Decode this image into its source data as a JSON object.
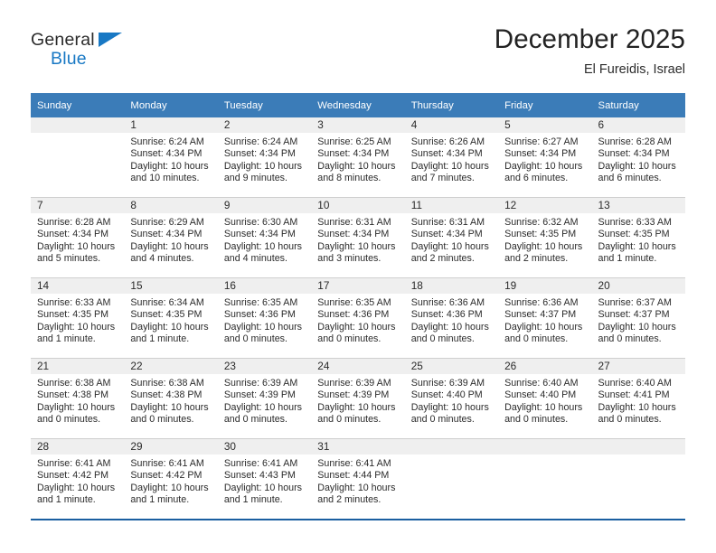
{
  "brand": {
    "name_part1": "General",
    "name_part2": "Blue",
    "triangle_icon": "triangle-icon",
    "accent_color": "#1878c4"
  },
  "header": {
    "title": "December 2025",
    "location": "El Fureidis, Israel"
  },
  "calendar": {
    "header_bg": "#3b7cb8",
    "daynum_bg": "#efefef",
    "weekday_headers": [
      "Sunday",
      "Monday",
      "Tuesday",
      "Wednesday",
      "Thursday",
      "Friday",
      "Saturday"
    ],
    "weeks": [
      [
        {
          "day": "",
          "blank": true
        },
        {
          "day": "1",
          "sunrise": "Sunrise: 6:24 AM",
          "sunset": "Sunset: 4:34 PM",
          "daylight1": "Daylight: 10 hours",
          "daylight2": "and 10 minutes."
        },
        {
          "day": "2",
          "sunrise": "Sunrise: 6:24 AM",
          "sunset": "Sunset: 4:34 PM",
          "daylight1": "Daylight: 10 hours",
          "daylight2": "and 9 minutes."
        },
        {
          "day": "3",
          "sunrise": "Sunrise: 6:25 AM",
          "sunset": "Sunset: 4:34 PM",
          "daylight1": "Daylight: 10 hours",
          "daylight2": "and 8 minutes."
        },
        {
          "day": "4",
          "sunrise": "Sunrise: 6:26 AM",
          "sunset": "Sunset: 4:34 PM",
          "daylight1": "Daylight: 10 hours",
          "daylight2": "and 7 minutes."
        },
        {
          "day": "5",
          "sunrise": "Sunrise: 6:27 AM",
          "sunset": "Sunset: 4:34 PM",
          "daylight1": "Daylight: 10 hours",
          "daylight2": "and 6 minutes."
        },
        {
          "day": "6",
          "sunrise": "Sunrise: 6:28 AM",
          "sunset": "Sunset: 4:34 PM",
          "daylight1": "Daylight: 10 hours",
          "daylight2": "and 6 minutes."
        }
      ],
      [
        {
          "day": "7",
          "sunrise": "Sunrise: 6:28 AM",
          "sunset": "Sunset: 4:34 PM",
          "daylight1": "Daylight: 10 hours",
          "daylight2": "and 5 minutes."
        },
        {
          "day": "8",
          "sunrise": "Sunrise: 6:29 AM",
          "sunset": "Sunset: 4:34 PM",
          "daylight1": "Daylight: 10 hours",
          "daylight2": "and 4 minutes."
        },
        {
          "day": "9",
          "sunrise": "Sunrise: 6:30 AM",
          "sunset": "Sunset: 4:34 PM",
          "daylight1": "Daylight: 10 hours",
          "daylight2": "and 4 minutes."
        },
        {
          "day": "10",
          "sunrise": "Sunrise: 6:31 AM",
          "sunset": "Sunset: 4:34 PM",
          "daylight1": "Daylight: 10 hours",
          "daylight2": "and 3 minutes."
        },
        {
          "day": "11",
          "sunrise": "Sunrise: 6:31 AM",
          "sunset": "Sunset: 4:34 PM",
          "daylight1": "Daylight: 10 hours",
          "daylight2": "and 2 minutes."
        },
        {
          "day": "12",
          "sunrise": "Sunrise: 6:32 AM",
          "sunset": "Sunset: 4:35 PM",
          "daylight1": "Daylight: 10 hours",
          "daylight2": "and 2 minutes."
        },
        {
          "day": "13",
          "sunrise": "Sunrise: 6:33 AM",
          "sunset": "Sunset: 4:35 PM",
          "daylight1": "Daylight: 10 hours",
          "daylight2": "and 1 minute."
        }
      ],
      [
        {
          "day": "14",
          "sunrise": "Sunrise: 6:33 AM",
          "sunset": "Sunset: 4:35 PM",
          "daylight1": "Daylight: 10 hours",
          "daylight2": "and 1 minute."
        },
        {
          "day": "15",
          "sunrise": "Sunrise: 6:34 AM",
          "sunset": "Sunset: 4:35 PM",
          "daylight1": "Daylight: 10 hours",
          "daylight2": "and 1 minute."
        },
        {
          "day": "16",
          "sunrise": "Sunrise: 6:35 AM",
          "sunset": "Sunset: 4:36 PM",
          "daylight1": "Daylight: 10 hours",
          "daylight2": "and 0 minutes."
        },
        {
          "day": "17",
          "sunrise": "Sunrise: 6:35 AM",
          "sunset": "Sunset: 4:36 PM",
          "daylight1": "Daylight: 10 hours",
          "daylight2": "and 0 minutes."
        },
        {
          "day": "18",
          "sunrise": "Sunrise: 6:36 AM",
          "sunset": "Sunset: 4:36 PM",
          "daylight1": "Daylight: 10 hours",
          "daylight2": "and 0 minutes."
        },
        {
          "day": "19",
          "sunrise": "Sunrise: 6:36 AM",
          "sunset": "Sunset: 4:37 PM",
          "daylight1": "Daylight: 10 hours",
          "daylight2": "and 0 minutes."
        },
        {
          "day": "20",
          "sunrise": "Sunrise: 6:37 AM",
          "sunset": "Sunset: 4:37 PM",
          "daylight1": "Daylight: 10 hours",
          "daylight2": "and 0 minutes."
        }
      ],
      [
        {
          "day": "21",
          "sunrise": "Sunrise: 6:38 AM",
          "sunset": "Sunset: 4:38 PM",
          "daylight1": "Daylight: 10 hours",
          "daylight2": "and 0 minutes."
        },
        {
          "day": "22",
          "sunrise": "Sunrise: 6:38 AM",
          "sunset": "Sunset: 4:38 PM",
          "daylight1": "Daylight: 10 hours",
          "daylight2": "and 0 minutes."
        },
        {
          "day": "23",
          "sunrise": "Sunrise: 6:39 AM",
          "sunset": "Sunset: 4:39 PM",
          "daylight1": "Daylight: 10 hours",
          "daylight2": "and 0 minutes."
        },
        {
          "day": "24",
          "sunrise": "Sunrise: 6:39 AM",
          "sunset": "Sunset: 4:39 PM",
          "daylight1": "Daylight: 10 hours",
          "daylight2": "and 0 minutes."
        },
        {
          "day": "25",
          "sunrise": "Sunrise: 6:39 AM",
          "sunset": "Sunset: 4:40 PM",
          "daylight1": "Daylight: 10 hours",
          "daylight2": "and 0 minutes."
        },
        {
          "day": "26",
          "sunrise": "Sunrise: 6:40 AM",
          "sunset": "Sunset: 4:40 PM",
          "daylight1": "Daylight: 10 hours",
          "daylight2": "and 0 minutes."
        },
        {
          "day": "27",
          "sunrise": "Sunrise: 6:40 AM",
          "sunset": "Sunset: 4:41 PM",
          "daylight1": "Daylight: 10 hours",
          "daylight2": "and 0 minutes."
        }
      ],
      [
        {
          "day": "28",
          "sunrise": "Sunrise: 6:41 AM",
          "sunset": "Sunset: 4:42 PM",
          "daylight1": "Daylight: 10 hours",
          "daylight2": "and 1 minute."
        },
        {
          "day": "29",
          "sunrise": "Sunrise: 6:41 AM",
          "sunset": "Sunset: 4:42 PM",
          "daylight1": "Daylight: 10 hours",
          "daylight2": "and 1 minute."
        },
        {
          "day": "30",
          "sunrise": "Sunrise: 6:41 AM",
          "sunset": "Sunset: 4:43 PM",
          "daylight1": "Daylight: 10 hours",
          "daylight2": "and 1 minute."
        },
        {
          "day": "31",
          "sunrise": "Sunrise: 6:41 AM",
          "sunset": "Sunset: 4:44 PM",
          "daylight1": "Daylight: 10 hours",
          "daylight2": "and 2 minutes."
        },
        {
          "day": "",
          "empty": true
        },
        {
          "day": "",
          "empty": true
        },
        {
          "day": "",
          "empty": true
        }
      ]
    ]
  }
}
